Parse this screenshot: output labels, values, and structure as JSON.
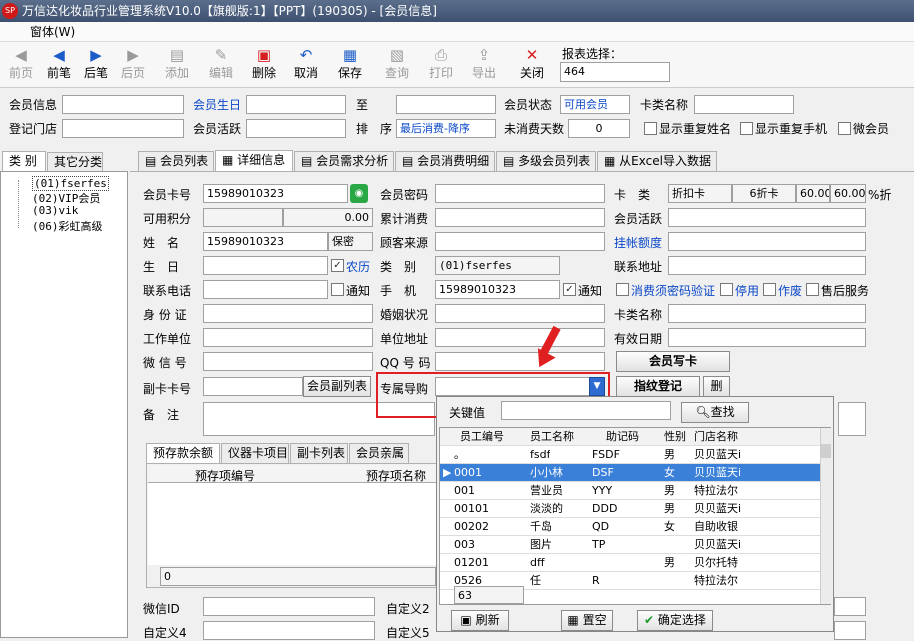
{
  "window": {
    "title": "万信达化妆品行业管理系统V10.0【旗舰版:1】【PPT】(190305) - [会员信息]",
    "menu": "窗体(W)"
  },
  "toolbar": {
    "items": [
      "前页",
      "前笔",
      "后笔",
      "后页",
      "添加",
      "编辑",
      "删除",
      "取消",
      "保存",
      "查询",
      "打印",
      "导出",
      "关闭"
    ],
    "report_label": "报表选择：",
    "report_value": "464"
  },
  "filters": {
    "member_info": "会员信息",
    "birthday": "会员生日",
    "to": "至",
    "status_label": "会员状态",
    "status_value": "可用会员",
    "card_type": "卡类名称",
    "store": "登记门店",
    "active": "会员活跃",
    "sort_label": "排　序",
    "sort_value": "最后消费-降序",
    "no_consume_days": "未消费天数",
    "no_consume_value": "0",
    "dup_name": "显示重复姓名",
    "dup_phone": "显示重复手机",
    "wechat_member": "微会员"
  },
  "left": {
    "tab1": "类 别",
    "tab2": "其它分类",
    "tree": [
      "(01)fserfes",
      "(02)VIP会员",
      "(03)vik",
      "(06)彩虹高级"
    ]
  },
  "tabs": [
    "会员列表",
    "详细信息",
    "会员需求分析",
    "会员消费明细",
    "多级会员列表",
    "从Excel导入数据"
  ],
  "form": {
    "card_no_label": "会员卡号",
    "card_no": "15989010323",
    "pwd_label": "会员密码",
    "cardtype_label": "卡　类",
    "cardtype": "折扣卡",
    "cardtype_disc": "6折卡",
    "disc1": "60.00",
    "disc2": "60.00",
    "disc_unit": "%折",
    "points_label": "可用积分",
    "points": "0.00",
    "total_label": "累计消费",
    "active_label": "会员活跃",
    "name_label": "姓　名",
    "name": "15989010323",
    "secret": "保密",
    "source_label": "顾客来源",
    "tag_label": "挂帐额度",
    "bday_label": "生　日",
    "lunar": "农历",
    "category_label": "类　别",
    "category": "(01)fserfes",
    "contact_addr_label": "联系地址",
    "phone_label": "联系电话",
    "notify": "通知",
    "mobile_label": "手　机",
    "mobile": "15989010323",
    "mobile_notify": "通知",
    "verify": "消费须密码验证",
    "disable": "停用",
    "void": "作废",
    "after_sale": "售后服务",
    "id_label": "身 份 证",
    "marriage_label": "婚姻状况",
    "card_name_label": "卡类名称",
    "work_label": "工作单位",
    "work_addr_label": "单位地址",
    "valid_label": "有效日期",
    "wechat_label": "微 信 号",
    "qq_label": "QQ 号 码",
    "write_card": "会员写卡",
    "sub_card_label": "副卡卡号",
    "sub_card_btn": "会员副列表",
    "guide_label": "专属导购",
    "finger_btn": "指纹登记",
    "del_btn": "删",
    "remark_label": "备　注"
  },
  "subtabs": [
    "预存款余额",
    "仪器卡项目",
    "副卡列表",
    "会员亲属"
  ],
  "subgrid": {
    "headers": [
      "预存项编号",
      "预存项名称"
    ],
    "footer": "0"
  },
  "bottom": {
    "wechat_id": "微信ID",
    "custom2": "自定义2",
    "custom4": "自定义4",
    "custom5": "自定义5"
  },
  "popup": {
    "keyword_label": "关键值",
    "search_btn": "查找",
    "headers": [
      "员工编号",
      "员工名称",
      "助记码",
      "性别",
      "门店名称"
    ],
    "rows": [
      [
        "。",
        "fsdf",
        "FSDF",
        "男",
        "贝贝蓝天i"
      ],
      [
        "0001",
        "小小林",
        "DSF",
        "女",
        "贝贝蓝天i"
      ],
      [
        "001",
        "营业员",
        "YYY",
        "男",
        "特拉法尔"
      ],
      [
        "00101",
        "淡淡的",
        "DDD",
        "男",
        "贝贝蓝天i"
      ],
      [
        "00202",
        "千岛",
        "QD",
        "女",
        "自助收银"
      ],
      [
        "003",
        "图片",
        "TP",
        "",
        "贝贝蓝天i"
      ],
      [
        "01201",
        "dff",
        "",
        "男",
        "贝尔托特"
      ],
      [
        "0526",
        "任",
        "R",
        "",
        "特拉法尔"
      ]
    ],
    "count": "63",
    "refresh": "刷新",
    "clear": "置空",
    "confirm": "确定选择"
  }
}
